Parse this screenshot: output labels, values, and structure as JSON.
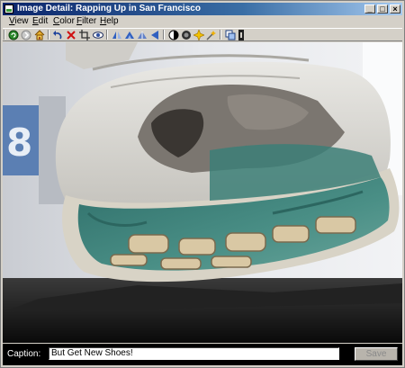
{
  "window": {
    "title": "Image Detail: Rapping Up in San Francisco",
    "controls": [
      "minimize",
      "maximize",
      "close"
    ]
  },
  "menu": [
    {
      "label": "View",
      "accel": "V",
      "rest": "iew"
    },
    {
      "label": "Edit",
      "accel": "E",
      "rest": "dit"
    },
    {
      "label": "Color",
      "accel": "C",
      "rest": "olor"
    },
    {
      "label": "Filter",
      "accel": "F",
      "rest": "ilter"
    },
    {
      "label": "Help",
      "accel": "H",
      "rest": "elp"
    }
  ],
  "toolbar": {
    "icons": [
      "refresh-icon",
      "forward-icon",
      "home-icon",
      "undo-icon",
      "delete-icon",
      "crop-icon",
      "red-eye-icon",
      "flip-horizontal-icon",
      "flip-vertical-icon",
      "rotate-left-icon",
      "rotate-right-icon",
      "contrast-icon",
      "brightness-icon",
      "sharpen-icon",
      "effects-icon",
      "copy-icon",
      "more-icon"
    ]
  },
  "photo": {
    "subject": "worn-shoe-sole-photo"
  },
  "caption": {
    "label": "Caption:",
    "value": "But Get New Shoes!",
    "save_label": "Save"
  },
  "colors": {
    "titlebar_start": "#0a246a",
    "titlebar_end": "#a6caf0",
    "caption_bar": "#000000",
    "window_face": "#d4d0c8"
  }
}
